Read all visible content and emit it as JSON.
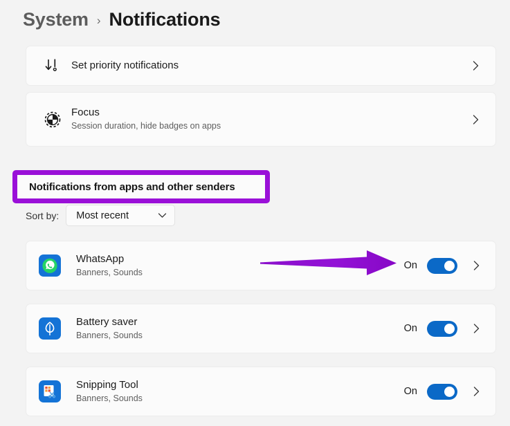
{
  "header": {
    "parent": "System",
    "separator": "›",
    "current": "Notifications"
  },
  "settings_cards": [
    {
      "id": "set-priority-notifications",
      "title": "Set priority notifications",
      "subtitle": "",
      "icon": "priority-notification-icon",
      "chevron": "›"
    },
    {
      "id": "focus",
      "title": "Focus",
      "subtitle": "Session duration, hide badges on apps",
      "icon": "focus-icon",
      "chevron": "›"
    }
  ],
  "section": {
    "title": "Notifications from apps and other senders",
    "highlight_color": "#9a10d8"
  },
  "sort": {
    "label": "Sort by:",
    "selected": "Most recent",
    "chevron": "∨",
    "options": [
      "Most recent"
    ]
  },
  "apps": [
    {
      "name": "WhatsApp",
      "subtitle": "Banners, Sounds",
      "state": "On",
      "toggle_on": true,
      "icon": "whatsapp-icon",
      "chevron": "›"
    },
    {
      "name": "Battery saver",
      "subtitle": "Banners, Sounds",
      "state": "On",
      "toggle_on": true,
      "icon": "battery-saver-icon",
      "chevron": "›"
    },
    {
      "name": "Snipping Tool",
      "subtitle": "Banners, Sounds",
      "state": "On",
      "toggle_on": true,
      "icon": "snipping-tool-icon",
      "chevron": "›"
    }
  ],
  "annotations": {
    "arrow": {
      "name": "purple-arrow-annotation",
      "color": "#8c10cf",
      "points_to": "WhatsApp toggle"
    }
  },
  "colors": {
    "page_background": "#f3f3f3",
    "card_background": "#fbfbfb",
    "toggle_accent": "#0b69c7",
    "annotation_purple": "#9a10d8"
  }
}
